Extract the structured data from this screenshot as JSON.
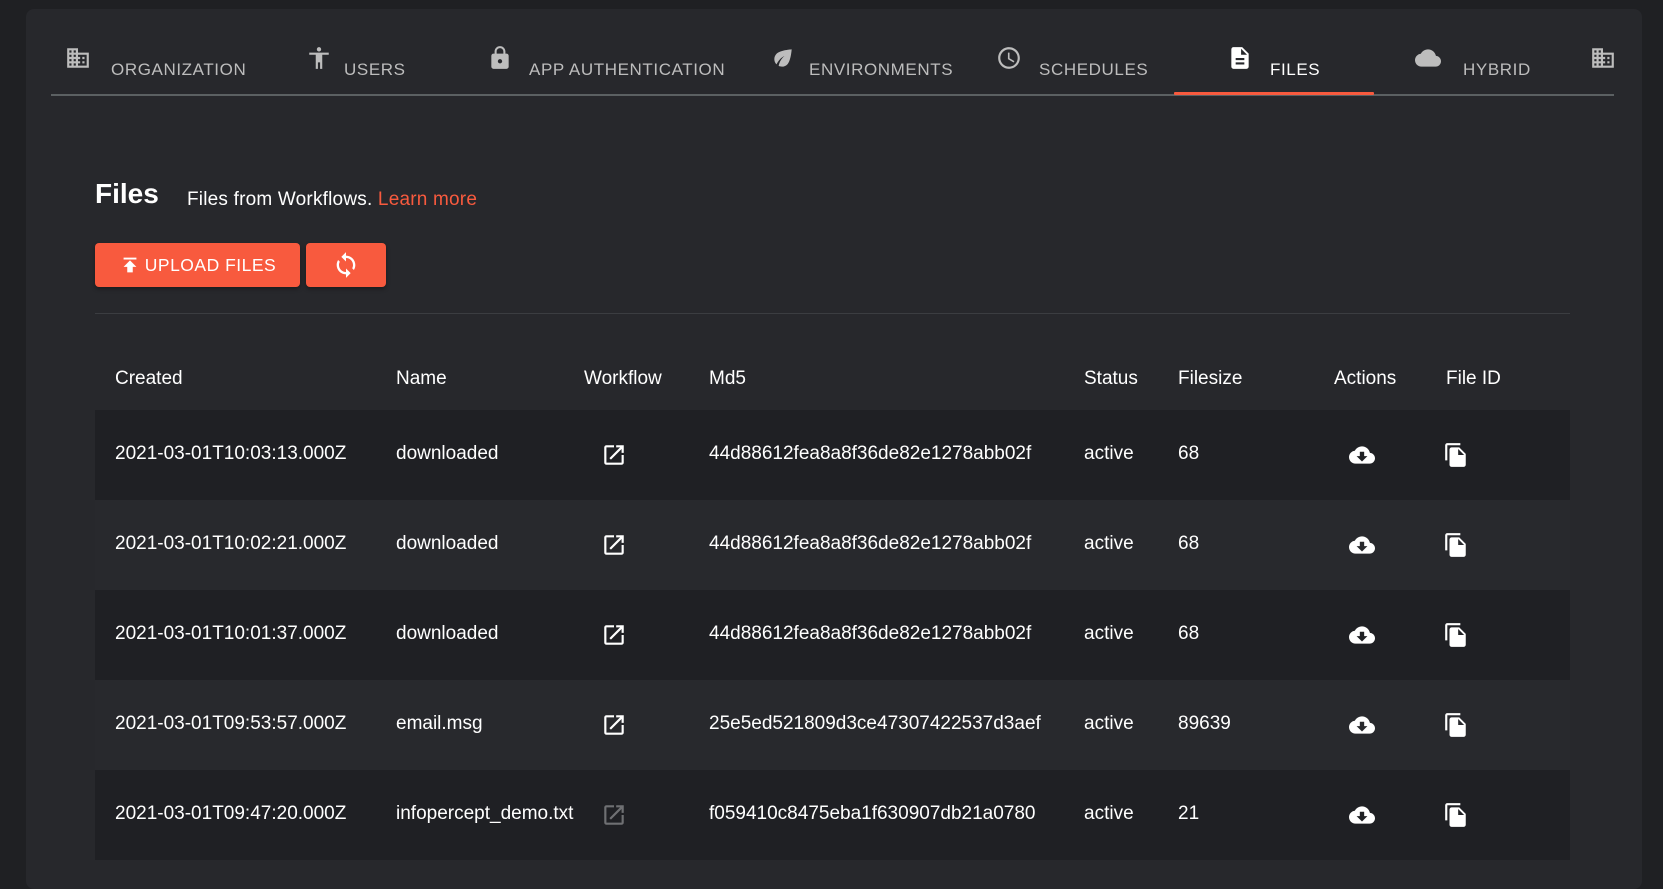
{
  "tabs": [
    {
      "label": "Organization",
      "icon": "building-icon",
      "active": false
    },
    {
      "label": "Users",
      "icon": "accessibility-icon",
      "active": false
    },
    {
      "label": "App Authentication",
      "icon": "lock-icon",
      "active": false
    },
    {
      "label": "Environments",
      "icon": "leaf-icon",
      "active": false
    },
    {
      "label": "Schedules",
      "icon": "clock-icon",
      "active": false
    },
    {
      "label": "Files",
      "icon": "file-icon",
      "active": true
    },
    {
      "label": "Hybrid",
      "icon": "cloud-icon",
      "active": false
    },
    {
      "label": "",
      "icon": "building-icon",
      "active": false
    }
  ],
  "colors": {
    "accent": "#f85a3e",
    "panel": "#27282c",
    "background": "#1f2023"
  },
  "header": {
    "title": "Files",
    "description": "Files from Workflows.",
    "learn_more": "Learn more"
  },
  "toolbar": {
    "upload_label": "UPLOAD FILES",
    "upload_icon": "upload-icon",
    "refresh_icon": "refresh-icon"
  },
  "table": {
    "columns": [
      "Created",
      "Name",
      "Workflow",
      "Md5",
      "Status",
      "Filesize",
      "Actions",
      "File ID"
    ],
    "rows": [
      {
        "created": "2021-03-01T10:03:13.000Z",
        "name": "downloaded",
        "workflow_enabled": true,
        "md5": "44d88612fea8a8f36de82e1278abb02f",
        "status": "active",
        "filesize": "68"
      },
      {
        "created": "2021-03-01T10:02:21.000Z",
        "name": "downloaded",
        "workflow_enabled": true,
        "md5": "44d88612fea8a8f36de82e1278abb02f",
        "status": "active",
        "filesize": "68"
      },
      {
        "created": "2021-03-01T10:01:37.000Z",
        "name": "downloaded",
        "workflow_enabled": true,
        "md5": "44d88612fea8a8f36de82e1278abb02f",
        "status": "active",
        "filesize": "68"
      },
      {
        "created": "2021-03-01T09:53:57.000Z",
        "name": "email.msg",
        "workflow_enabled": true,
        "md5": "25e5ed521809d3ce47307422537d3aef",
        "status": "active",
        "filesize": "89639"
      },
      {
        "created": "2021-03-01T09:47:20.000Z",
        "name": "infopercept_demo.txt",
        "workflow_enabled": false,
        "md5": "f059410c8475eba1f630907db21a0780",
        "status": "active",
        "filesize": "21"
      }
    ]
  }
}
